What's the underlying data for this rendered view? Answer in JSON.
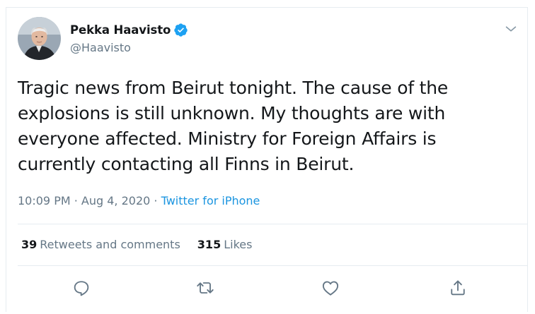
{
  "tweet": {
    "author_name": "Pekka Haavisto",
    "author_handle": "@Haavisto",
    "text": "Tragic news from Beirut tonight. The cause of the explosions is still unknown. My thoughts are with everyone affected. Ministry for Foreign Affairs is currently contacting all Finns in Beirut.",
    "time": "10:09 PM",
    "separator1": " · ",
    "date": "Aug 4, 2020",
    "separator2": " · ",
    "source": "Twitter for iPhone"
  },
  "stats": {
    "retweets_count": "39",
    "retweets_label": "Retweets and comments",
    "likes_count": "315",
    "likes_label": "Likes"
  },
  "icons": {
    "verified": "verified-badge-icon",
    "caret": "chevron-down-icon",
    "reply": "reply-icon",
    "retweet": "retweet-icon",
    "like": "heart-icon",
    "share": "share-icon"
  },
  "colors": {
    "text": "#14171a",
    "secondary": "#657786",
    "link": "#1b95e0",
    "verified": "#1da1f2",
    "border": "#e6ecf0"
  }
}
